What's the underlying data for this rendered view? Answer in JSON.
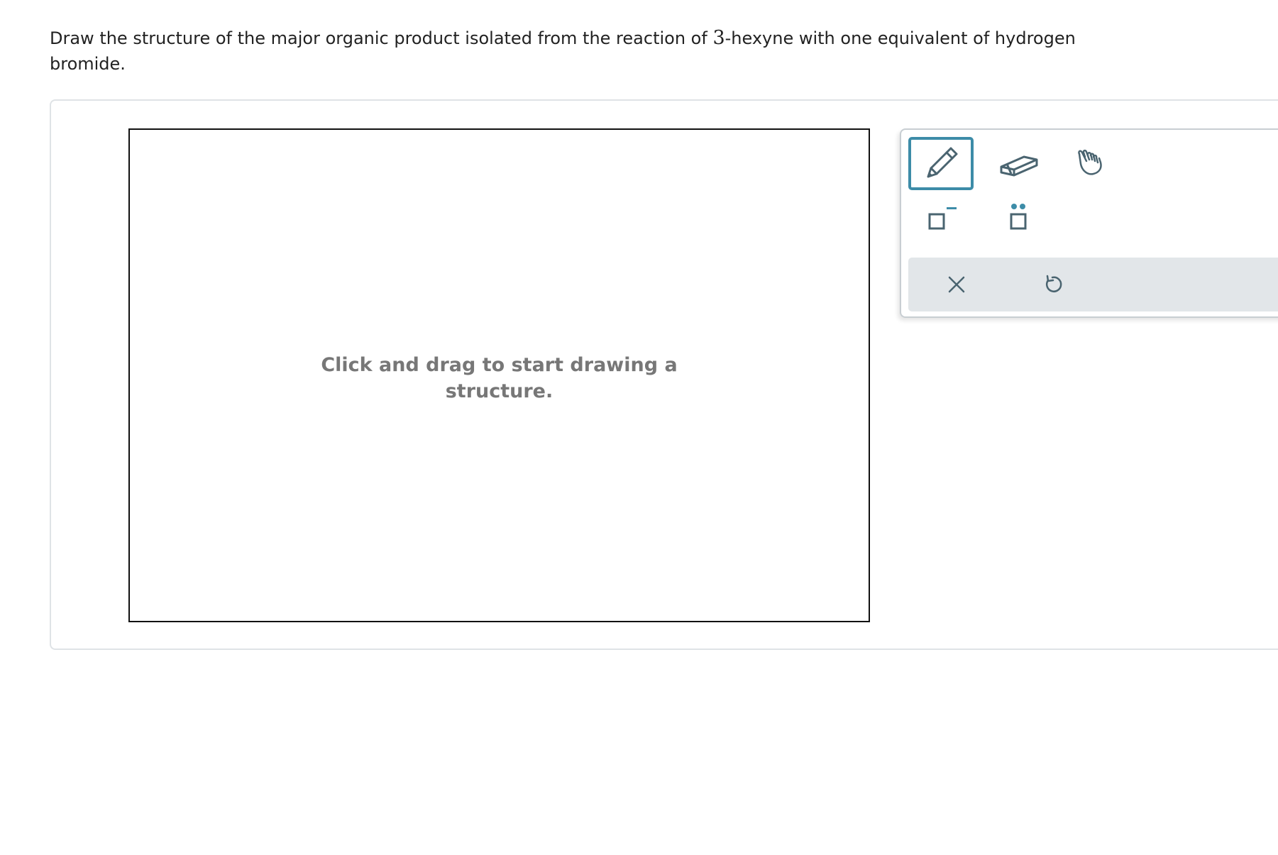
{
  "question": {
    "text_before": "Draw the structure of the major organic product isolated from the reaction of ",
    "number": "3",
    "text_after": "-hexyne with one equivalent of hydrogen bromide."
  },
  "canvas": {
    "hint": "Click and drag to start drawing a structure."
  },
  "toolbar": {
    "tools": [
      {
        "name": "pencil",
        "icon": "pencil-icon",
        "selected": true
      },
      {
        "name": "eraser",
        "icon": "eraser-icon",
        "selected": false
      },
      {
        "name": "hand",
        "icon": "hand-icon",
        "selected": false
      },
      {
        "name": "charge",
        "icon": "negative-charge-icon",
        "selected": false
      },
      {
        "name": "lone-pair",
        "icon": "lone-pair-icon",
        "selected": false
      }
    ],
    "actions": [
      {
        "name": "clear",
        "icon": "x-icon"
      },
      {
        "name": "undo",
        "icon": "undo-icon"
      }
    ]
  },
  "colors": {
    "accent": "#3d8ca8",
    "icon": "#4a6470",
    "hint_text": "#777777",
    "action_bar_bg": "#e2e6e9"
  }
}
